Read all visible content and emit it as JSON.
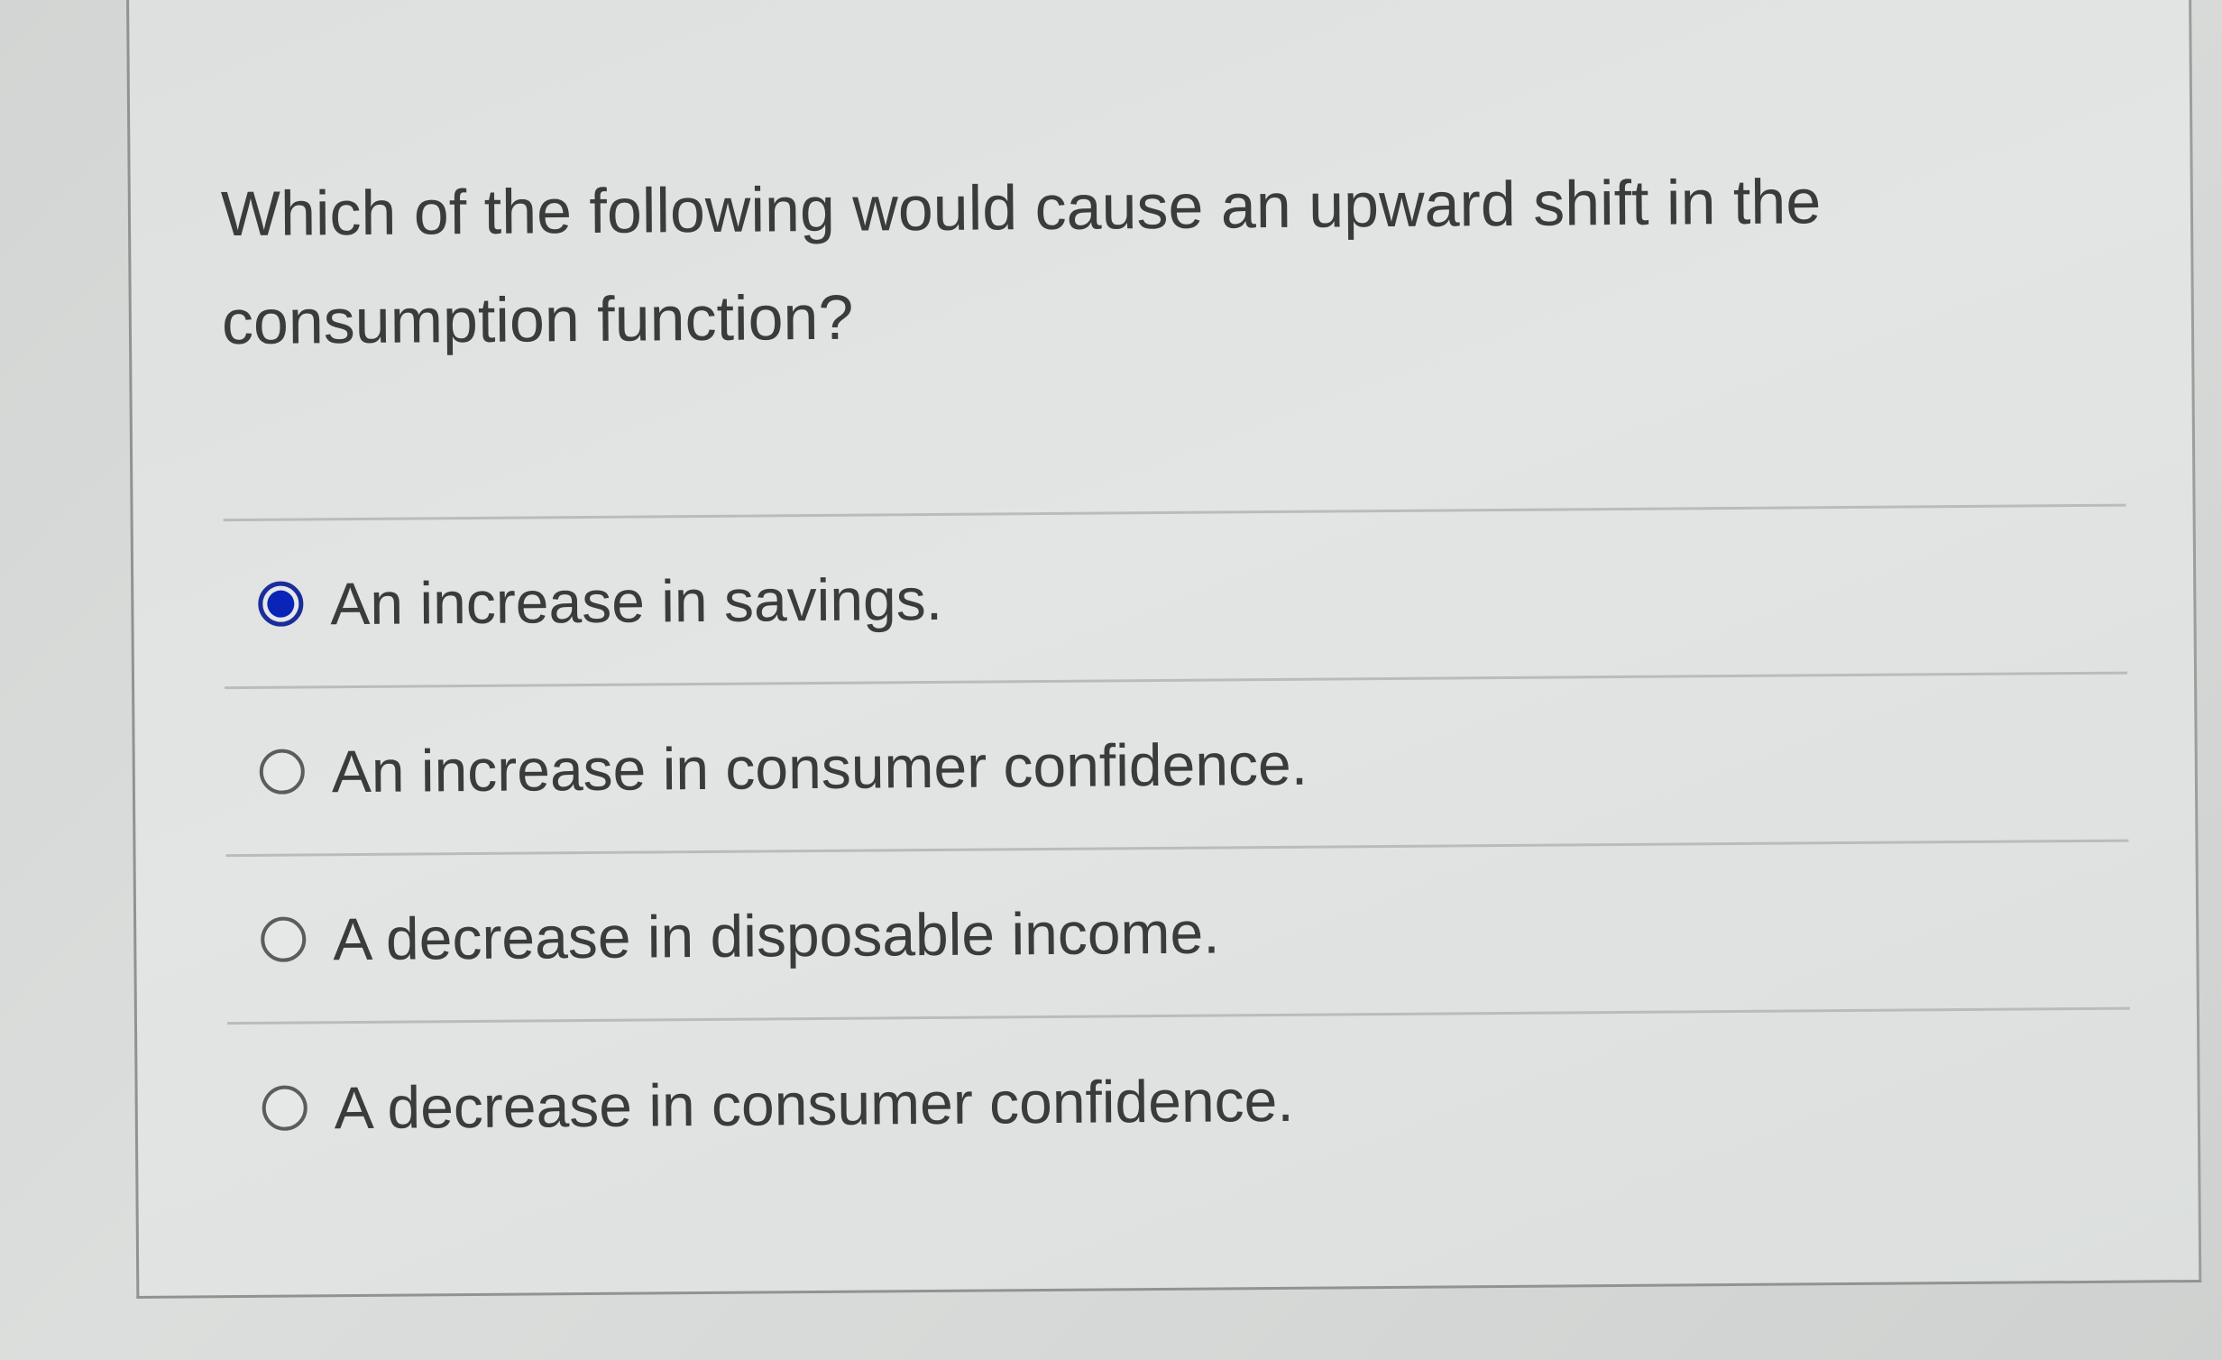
{
  "question": {
    "text": "Which of the following would cause an upward shift in the consumption function?"
  },
  "options": [
    {
      "label": "An increase in savings.",
      "selected": true
    },
    {
      "label": "An increase in consumer confidence.",
      "selected": false
    },
    {
      "label": "A decrease in disposable income.",
      "selected": false
    },
    {
      "label": "A decrease in consumer confidence.",
      "selected": false
    }
  ],
  "colors": {
    "selected_radio": "#0a24b8",
    "text": "#3a3c3c"
  }
}
